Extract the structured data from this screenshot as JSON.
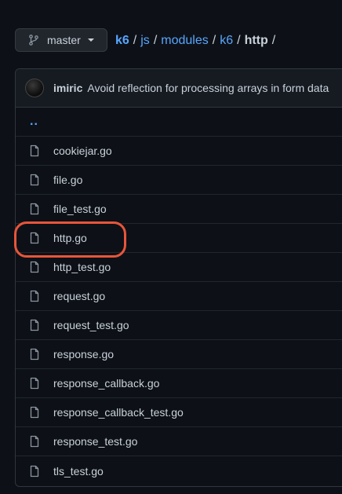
{
  "branch": {
    "name": "master"
  },
  "breadcrumb": {
    "items": [
      "k6",
      "js",
      "modules",
      "k6"
    ],
    "current": "http",
    "separator": "/"
  },
  "commit": {
    "author": "imiric",
    "message": "Avoid reflection for processing arrays in form data"
  },
  "parent_dir": "..",
  "files": [
    "cookiejar.go",
    "file.go",
    "file_test.go",
    "http.go",
    "http_test.go",
    "request.go",
    "request_test.go",
    "response.go",
    "response_callback.go",
    "response_callback_test.go",
    "response_test.go",
    "tls_test.go"
  ],
  "highlighted_file": "http.go",
  "colors": {
    "background": "#0d1117",
    "link": "#58a6ff",
    "text": "#c9d1d9",
    "highlight": "#e8553a"
  }
}
